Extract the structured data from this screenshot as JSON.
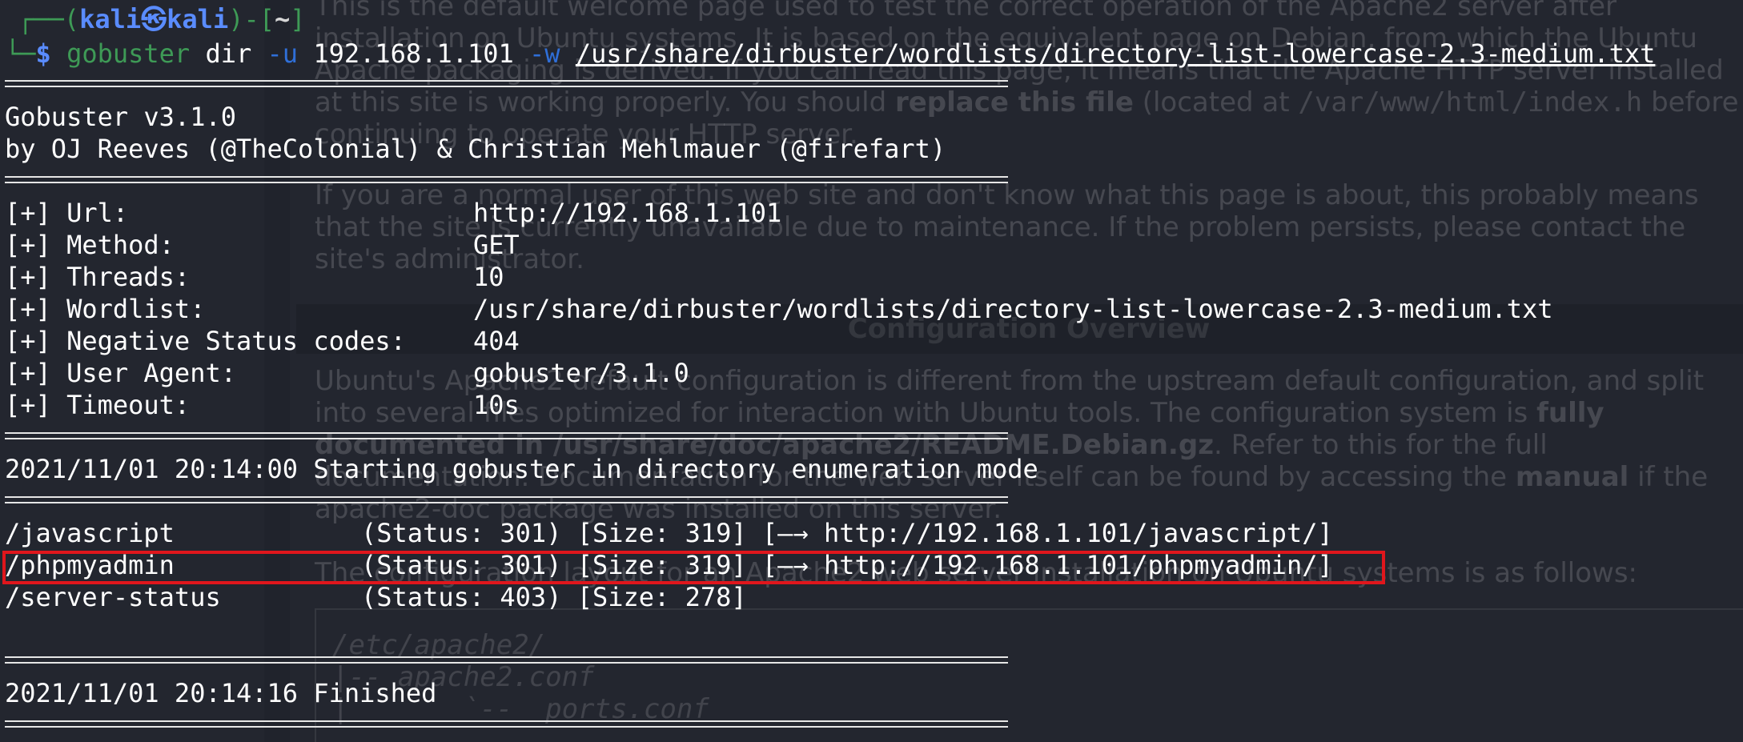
{
  "background_page": {
    "paragraphs": [
      "This is the default welcome page used to test the correct operation of the Apache2 server after installation on Ubuntu systems. It is based on the equivalent page on Debian, from which the Ubuntu Apache packaging is derived. If you can read this page, it means that the Apache HTTP server installed at this site is working properly. You should",
      "replace this file",
      "(located at",
      "/var/www/html/index.h",
      "before continuing to operate your HTTP server.",
      "If you are a normal user of this web site and don't know what this page is about, this probably means that the site is currently unavailable due to maintenance. If the problem persists, please contact the site's administrator."
    ],
    "section_title": "Configuration Overview",
    "config_text_1": "Ubuntu's Apache2 default configuration is different from the upstream default configuration, and split into several files optimized for interaction with Ubuntu tools. The configuration system is",
    "config_bold": "fully documented in /usr/share/doc/apache2/README.Debian.gz",
    "config_text_2": ". Refer to this for the full documentation. Documentation for the web server itself can be found by accessing the",
    "config_manual": "manual",
    "config_text_3": "if the apache2-doc package was installed on this server.",
    "layout_text": "The configuration layout for an Apache2 web server installation on Ubuntu systems is as follows:",
    "code_lines": [
      "/etc/apache2/",
      "|-- apache2.conf",
      "|       `--  ports.conf"
    ]
  },
  "terminal": {
    "prompt": {
      "open": "┌──(",
      "user": "kali",
      "at_symbol": "㉿",
      "host": "kali",
      "mid": ")-[",
      "cwd": "~",
      "close": "]",
      "corner": "└─",
      "dollar": "$",
      "command": "gobuster",
      "sub": "dir",
      "flag_u": "-u",
      "target": "192.168.1.101",
      "flag_w": "-w",
      "wordlist_path": "/usr/share/dirbuster/wordlists/directory-list-lowercase-2.3-medium.txt"
    },
    "banner": {
      "version": "Gobuster v3.1.0",
      "authors": "by OJ Reeves (@TheColonial) & Christian Mehlmauer (@firefart)"
    },
    "config": [
      {
        "key": "[+] Url:",
        "value": "http://192.168.1.101"
      },
      {
        "key": "[+] Method:",
        "value": "GET"
      },
      {
        "key": "[+] Threads:",
        "value": "10"
      },
      {
        "key": "[+] Wordlist:",
        "value": "/usr/share/dirbuster/wordlists/directory-list-lowercase-2.3-medium.txt"
      },
      {
        "key": "[+] Negative Status codes:",
        "value": "404"
      },
      {
        "key": "[+] User Agent:",
        "value": "gobuster/3.1.0"
      },
      {
        "key": "[+] Timeout:",
        "value": "10s"
      }
    ],
    "start_message": "2021/11/01 20:14:00 Starting gobuster in directory enumeration mode",
    "results": [
      {
        "path": "/javascript",
        "info": "(Status: 301) [Size: 319] [—→ http://192.168.1.101/javascript/]"
      },
      {
        "path": "/phpmyadmin",
        "info": "(Status: 301) [Size: 319] [—→ http://192.168.1.101/phpmyadmin/]"
      },
      {
        "path": "/server-status",
        "info": "(Status: 403) [Size: 278]"
      }
    ],
    "finish_message": "2021/11/01 20:14:16 Finished"
  },
  "colors": {
    "terminal_bg": "#23262f",
    "prompt_blue": "#5a8cff",
    "prompt_green": "#3e9a56",
    "flag_blue": "#2f6fd8",
    "highlight_red": "#e0161c"
  }
}
